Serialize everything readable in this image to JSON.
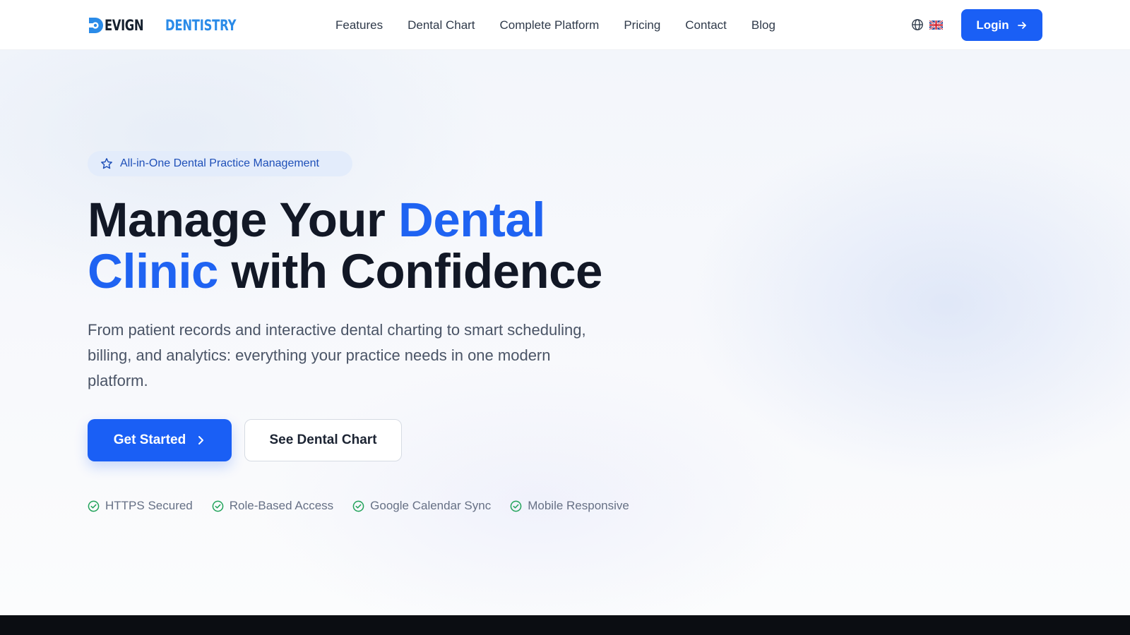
{
  "brand": {
    "name_part1": "EVIGN",
    "name_part2": "DENTISTRY",
    "accent_color": "#2a8be8"
  },
  "nav": {
    "items": [
      {
        "label": "Features"
      },
      {
        "label": "Dental Chart"
      },
      {
        "label": "Complete Platform"
      },
      {
        "label": "Pricing"
      },
      {
        "label": "Contact"
      },
      {
        "label": "Blog"
      }
    ],
    "language_icon": "globe-icon",
    "language_flag": "uk-flag-icon",
    "login_label": "Login"
  },
  "hero": {
    "badge": "All-in-One Dental Practice Management",
    "headline": {
      "part1": "Manage Your ",
      "part2_highlight": "Dental",
      "part3_highlight": "Clinic",
      "part4": " with Confidence"
    },
    "subtext": "From patient records and interactive dental charting to smart scheduling, billing, and analytics: everything your practice needs in one modern platform.",
    "primary_cta": "Get Started",
    "secondary_cta": "See Dental Chart",
    "features": [
      {
        "label": "HTTPS Secured",
        "icon": "check-circle-icon"
      },
      {
        "label": "Role-Based Access",
        "icon": "check-circle-icon"
      },
      {
        "label": "Google Calendar Sync",
        "icon": "check-circle-icon"
      },
      {
        "label": "Mobile Responsive",
        "icon": "check-circle-icon"
      }
    ]
  },
  "colors": {
    "primary": "#1a5ff5",
    "headline_dark": "#121826",
    "headline_blue": "#1f63f2",
    "check_green": "#22a35a"
  }
}
